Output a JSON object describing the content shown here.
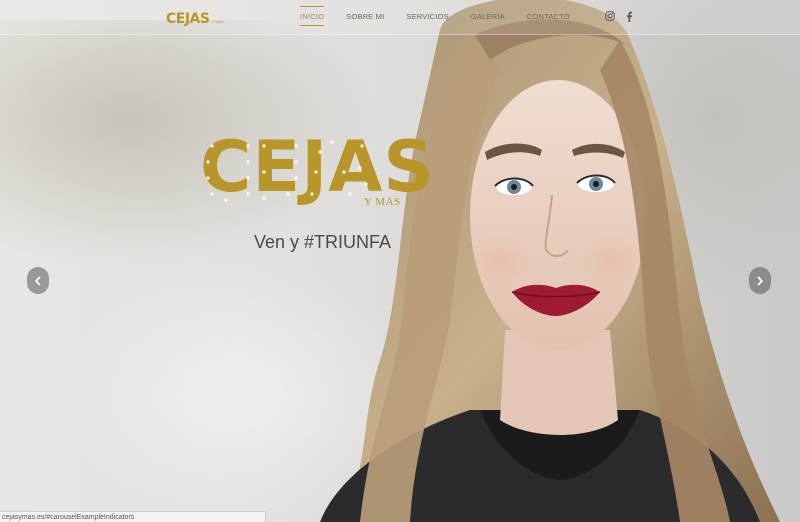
{
  "header": {
    "logo_text": "CEJAS",
    "logo_sub": "Y MAS",
    "nav": [
      {
        "label": "INICIO",
        "active": true
      },
      {
        "label": "SOBRE MI",
        "active": false
      },
      {
        "label": "SERVICIOS",
        "active": false
      },
      {
        "label": "GALERÍA",
        "active": false
      },
      {
        "label": "CONTACTO",
        "active": false
      }
    ],
    "social": [
      "instagram-icon",
      "facebook-icon"
    ]
  },
  "hero": {
    "brand": "CEJAS",
    "brand_sub": "Y MAS",
    "tagline": "Ven y #TRIUNFA"
  },
  "carousel": {
    "prev_icon": "chevron-left-icon",
    "next_icon": "chevron-right-icon"
  },
  "status_bar": {
    "url": "cejasymas.es/#carouselExampleIndicators"
  },
  "colors": {
    "gold": "#b8962a",
    "nav_text": "#6a6760",
    "tagline": "#4a4a4a"
  }
}
